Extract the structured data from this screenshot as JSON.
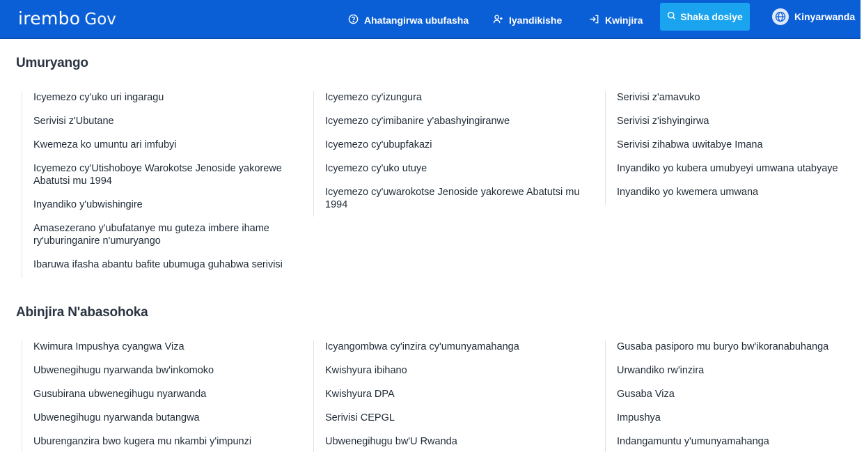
{
  "header": {
    "logo_main": "irembo",
    "logo_sub": "Gov",
    "help_label": "Ahatangirwa ubufasha",
    "register_label": "Iyandikishe",
    "login_label": "Kwinjira",
    "search_label": "Shaka dosiye",
    "language_label": "Kinyarwanda"
  },
  "sections": [
    {
      "title": "Umuryango",
      "columns": [
        [
          "Icyemezo cy'uko uri ingaragu",
          "Serivisi z'Ubutane",
          "Kwemeza ko umuntu ari imfubyi",
          "Icyemezo cy'Utishoboye Warokotse Jenoside yakorewe Abatutsi mu 1994",
          "Inyandiko y'ubwishingire",
          "Amasezerano y'ubufatanye mu guteza imbere ihame ry'uburinganire n'umuryango",
          "Ibaruwa ifasha abantu bafite ubumuga guhabwa serivisi"
        ],
        [
          "Icyemezo cy'izungura",
          "Icyemezo cy'imibanire y'abashyingiranwe",
          "Icyemezo cy'ubupfakazi",
          "Icyemezo cy'uko utuye",
          "Icyemezo cy'uwarokotse Jenoside yakorewe Abatutsi mu 1994"
        ],
        [
          "Serivisi z'amavuko",
          "Serivisi z'ishyingirwa",
          "Serivisi zihabwa uwitabye Imana",
          "Inyandiko yo kubera umubyeyi umwana utabyaye",
          "Inyandiko yo kwemera umwana"
        ]
      ]
    },
    {
      "title": "Abinjira N'abasohoka",
      "columns": [
        [
          "Kwimura Impushya cyangwa Viza",
          "Ubwenegihugu nyarwanda bw'inkomoko",
          "Gusubirana ubwenegihugu nyarwanda",
          "Ubwenegihugu nyarwanda butangwa",
          "Uburenganzira bwo kugera mu nkambi y'impunzi"
        ],
        [
          "Icyangombwa cy'inzira cy'umunyamahanga",
          "Kwishyura ibihano",
          "Kwishyura DPA",
          "Serivisi CEPGL",
          "Ubwenegihugu bw'U Rwanda"
        ],
        [
          "Gusaba pasiporo mu buryo bw'ikoranabuhanga",
          "Urwandiko rw'inzira",
          "Gusaba Viza",
          "Impushya",
          "Indangamuntu y'umunyamahanga"
        ]
      ]
    }
  ]
}
